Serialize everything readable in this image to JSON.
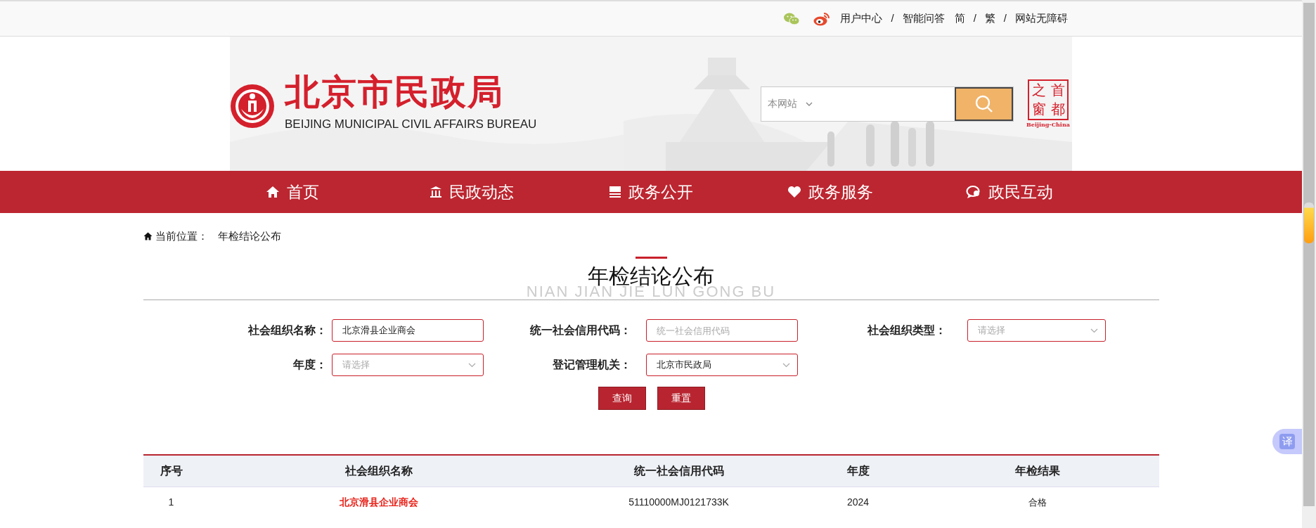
{
  "top_bar": {
    "items": [
      {
        "kind": "link",
        "label": "用户中心"
      },
      {
        "kind": "separator",
        "label": "/"
      },
      {
        "kind": "link",
        "label": "智能问答"
      },
      {
        "kind": "link",
        "label": "简"
      },
      {
        "kind": "separator",
        "label": "/"
      },
      {
        "kind": "link",
        "label": "繁"
      },
      {
        "kind": "separator",
        "label": "/"
      },
      {
        "kind": "link",
        "label": "网站无障碍"
      }
    ]
  },
  "header": {
    "title": "北京市民政局",
    "subtitle": "BEIJING MUNICIPAL CIVIL AFFAIRS BUREAU",
    "search": {
      "scope": "本网站"
    },
    "portal_badge": {
      "characters": [
        "之",
        "首",
        "窗",
        "都"
      ],
      "caption": "Beijing-China"
    }
  },
  "nav": {
    "items": [
      {
        "label": "首页"
      },
      {
        "label": "民政动态"
      },
      {
        "label": "政务公开"
      },
      {
        "label": "政务服务"
      },
      {
        "label": "政民互动"
      }
    ]
  },
  "breadcrumb": {
    "label": "当前位置：",
    "current": "年检结论公布"
  },
  "heading": {
    "title": "年检结论公布",
    "pinyin": "NIAN JIAN JIE LUN GONG BU"
  },
  "form": {
    "fields": [
      {
        "label": "社会组织名称：",
        "kind": "text",
        "value": "北京滑县企业商会"
      },
      {
        "label": "统一社会信用代码：",
        "kind": "text",
        "placeholder": "统一社会信用代码"
      },
      {
        "label": "社会组织类型：",
        "kind": "select",
        "placeholder": "请选择"
      },
      {
        "label": "年度：",
        "kind": "select",
        "placeholder": "请选择"
      },
      {
        "label": "登记管理机关：",
        "kind": "select",
        "value": "北京市民政局"
      }
    ],
    "buttons": [
      "查询",
      "重置"
    ]
  },
  "table": {
    "columns": [
      "序号",
      "社会组织名称",
      "统一社会信用代码",
      "年度",
      "年检结果"
    ],
    "rows": [
      [
        "1",
        "北京滑县企业商会",
        "51110000MJ0121733K",
        "2024",
        "合格"
      ]
    ]
  },
  "translate_button": {
    "label": "译"
  }
}
